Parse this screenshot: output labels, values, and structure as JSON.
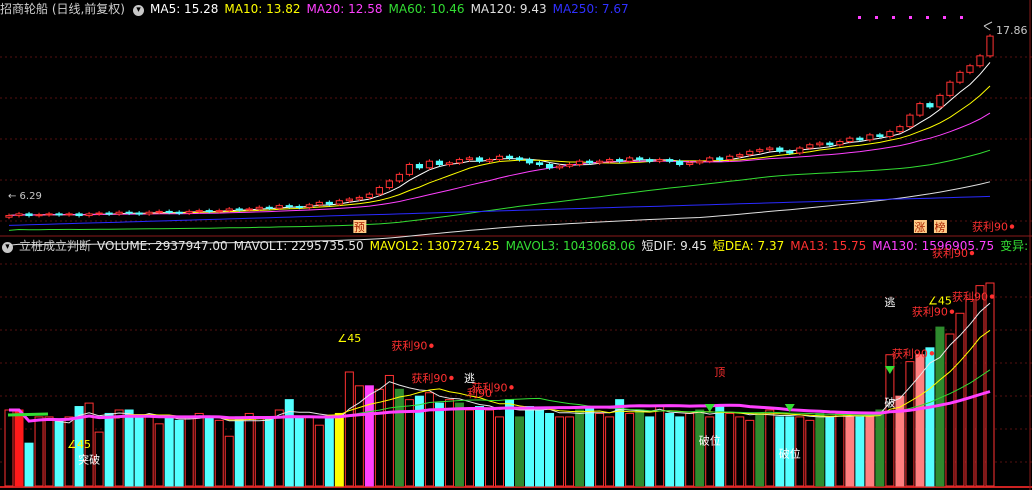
{
  "upper": {
    "title": "招商轮船 (日线,前复权)",
    "indicators": [
      {
        "label": "MA5: 15.28",
        "color": "#ffffff"
      },
      {
        "label": "MA10: 13.82",
        "color": "#ffff00"
      },
      {
        "label": "MA20: 12.58",
        "color": "#ff40ff"
      },
      {
        "label": "MA60: 10.46",
        "color": "#33dd33"
      },
      {
        "label": "MA120: 9.43",
        "color": "#e0e0e0"
      },
      {
        "label": "MA250: 7.67",
        "color": "#3030ff"
      }
    ],
    "price_high_label": "17.86",
    "price_low_label": "6.29",
    "markers": [
      {
        "text": "预",
        "index": 35
      },
      {
        "text": "涨",
        "index": 91
      },
      {
        "text": "榜",
        "index": 93
      }
    ]
  },
  "lower": {
    "title": "立桩成立判断",
    "indicators": [
      {
        "label": "VOLUME: 2937947.00",
        "color": "#e6e6e6"
      },
      {
        "label": "MAVOL1: 2295735.50",
        "color": "#e6e6e6"
      },
      {
        "label": "MAVOL2: 1307274.25",
        "color": "#ffff00"
      },
      {
        "label": "MAVOL3: 1043068.06",
        "color": "#33dd33"
      },
      {
        "label": "短DIF: 9.45",
        "color": "#e6e6e6"
      },
      {
        "label": "短DEA: 7.37",
        "color": "#ffff00"
      },
      {
        "label": "MA13: 15.75",
        "color": "#ff3030"
      },
      {
        "label": "MA130: 1596905.75",
        "color": "#ff40ff"
      },
      {
        "label": "变异: -",
        "color": "#33dd33"
      }
    ],
    "annotations": [
      {
        "text": "获利90",
        "color": "#ff3030",
        "index": 40,
        "lvl": 0.72
      },
      {
        "text": "获利90",
        "color": "#ff3030",
        "index": 42,
        "lvl": 0.55
      },
      {
        "text": "获利90",
        "color": "#ff3030",
        "index": 48,
        "lvl": 0.5
      },
      {
        "text": "利90",
        "color": "#ff3030",
        "index": 47,
        "lvl": 0.47
      },
      {
        "text": "获利90",
        "color": "#ff3030",
        "index": 90,
        "lvl": 0.68
      },
      {
        "text": "获利90",
        "color": "#ff3030",
        "index": 94,
        "lvl": 1.21
      },
      {
        "text": "获利90",
        "color": "#ff3030",
        "index": 98,
        "lvl": 1.35
      },
      {
        "text": "获利90",
        "color": "#ff3030",
        "index": 96,
        "lvl": 0.98
      },
      {
        "text": "获利90",
        "color": "#ff3030",
        "index": 92,
        "lvl": 0.9
      },
      {
        "text": "∠45",
        "color": "#ffff00",
        "index": 34,
        "lvl": 0.76
      },
      {
        "text": "∠45",
        "color": "#ffff00",
        "index": 93,
        "lvl": 0.96
      },
      {
        "text": "∠45",
        "color": "#ffff00",
        "index": 7,
        "lvl": 0.2
      },
      {
        "text": "逃",
        "color": "#ffffff",
        "index": 88,
        "lvl": 0.95
      },
      {
        "text": "逃",
        "color": "#ffffff",
        "index": 46,
        "lvl": 0.55
      },
      {
        "text": "顶",
        "color": "#ff3030",
        "index": 71,
        "lvl": 0.58
      },
      {
        "text": "破位",
        "color": "#ffffff",
        "index": 70,
        "lvl": 0.22
      },
      {
        "text": "破位",
        "color": "#ffffff",
        "index": 78,
        "lvl": 0.15
      },
      {
        "text": "突破",
        "color": "#ffffff",
        "index": 8,
        "lvl": 0.12
      },
      {
        "text": "破",
        "color": "#ffffff",
        "index": 88,
        "lvl": 0.42
      }
    ]
  },
  "chart_data": [
    {
      "type": "candlestick",
      "title": "招商轮船 (日线,前复权)",
      "series_names": [
        "MA5",
        "MA10",
        "MA20",
        "MA60",
        "MA120",
        "MA250"
      ],
      "ylim": [
        5.5,
        18.5
      ],
      "close": [
        6.5,
        6.6,
        6.5,
        6.55,
        6.6,
        6.55,
        6.6,
        6.5,
        6.6,
        6.65,
        6.6,
        6.7,
        6.65,
        6.6,
        6.7,
        6.75,
        6.7,
        6.65,
        6.75,
        6.8,
        6.75,
        6.8,
        6.9,
        6.85,
        6.9,
        7.0,
        6.95,
        7.1,
        7.05,
        7.0,
        7.15,
        7.3,
        7.2,
        7.4,
        7.5,
        7.6,
        7.8,
        8.2,
        8.6,
        9.0,
        9.6,
        9.4,
        9.8,
        9.6,
        9.7,
        9.9,
        10.0,
        9.8,
        9.9,
        10.1,
        10.0,
        9.9,
        9.7,
        9.6,
        9.4,
        9.5,
        9.6,
        9.8,
        9.7,
        9.8,
        9.9,
        9.8,
        10.0,
        9.9,
        9.8,
        9.9,
        9.8,
        9.6,
        9.7,
        9.8,
        10.0,
        9.9,
        10.1,
        10.2,
        10.4,
        10.5,
        10.6,
        10.4,
        10.3,
        10.6,
        10.8,
        10.9,
        10.8,
        11.0,
        11.2,
        11.1,
        11.4,
        11.3,
        11.6,
        11.9,
        12.6,
        13.3,
        13.1,
        13.8,
        14.6,
        15.2,
        15.6,
        16.2,
        17.4
      ],
      "open": [
        6.4,
        6.5,
        6.6,
        6.5,
        6.55,
        6.6,
        6.55,
        6.6,
        6.5,
        6.6,
        6.65,
        6.6,
        6.7,
        6.65,
        6.6,
        6.7,
        6.75,
        6.7,
        6.65,
        6.75,
        6.8,
        6.75,
        6.8,
        6.9,
        6.85,
        6.9,
        7.0,
        6.95,
        7.1,
        7.05,
        7.0,
        7.15,
        7.3,
        7.2,
        7.4,
        7.5,
        7.6,
        7.8,
        8.2,
        8.6,
        9.0,
        9.6,
        9.4,
        9.8,
        9.6,
        9.7,
        9.9,
        10.0,
        9.8,
        9.9,
        10.1,
        10.0,
        9.9,
        9.7,
        9.6,
        9.4,
        9.5,
        9.6,
        9.8,
        9.7,
        9.8,
        9.9,
        9.8,
        10.0,
        9.9,
        9.8,
        9.9,
        9.8,
        9.6,
        9.7,
        9.8,
        10.0,
        9.9,
        10.1,
        10.2,
        10.4,
        10.5,
        10.6,
        10.4,
        10.3,
        10.6,
        10.8,
        10.9,
        10.8,
        11.0,
        11.2,
        11.1,
        11.4,
        11.3,
        11.6,
        11.9,
        12.6,
        13.3,
        13.1,
        13.8,
        14.6,
        15.2,
        15.6,
        16.2
      ]
    },
    {
      "type": "bar",
      "title": "立桩成立判断",
      "series_names": [
        "VOLUME",
        "MAVOL1",
        "MAVOL2",
        "MAVOL3",
        "MA130"
      ],
      "ylim": [
        0,
        3300000
      ],
      "values": [
        1100000,
        1100000,
        620000,
        1000000,
        1000000,
        950000,
        1000000,
        1150000,
        1200000,
        780000,
        1050000,
        1100000,
        1100000,
        1000000,
        1000000,
        900000,
        1000000,
        950000,
        1000000,
        1050000,
        1000000,
        950000,
        720000,
        1000000,
        1050000,
        1000000,
        1000000,
        1100000,
        1250000,
        980000,
        1000000,
        880000,
        1000000,
        1050000,
        1650000,
        1450000,
        1450000,
        1400000,
        1600000,
        1400000,
        1250000,
        1300000,
        1350000,
        1200000,
        1250000,
        1200000,
        1100000,
        1150000,
        1100000,
        1000000,
        1250000,
        1000000,
        1150000,
        1100000,
        1050000,
        1000000,
        1000000,
        1100000,
        1150000,
        1050000,
        1000000,
        1250000,
        1050000,
        1100000,
        1000000,
        1150000,
        1050000,
        1000000,
        1050000,
        1100000,
        1000000,
        1150000,
        1050000,
        1000000,
        950000,
        1050000,
        1100000,
        1000000,
        1000000,
        1000000,
        950000,
        1050000,
        1000000,
        1050000,
        1000000,
        1000000,
        1050000,
        1100000,
        1900000,
        1300000,
        1800000,
        1900000,
        2000000,
        2300000,
        2200000,
        2500000,
        2700000,
        2900000,
        2937947
      ]
    }
  ]
}
